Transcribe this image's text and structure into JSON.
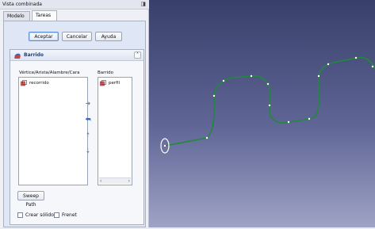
{
  "panel": {
    "title": "Vista combinada",
    "tabs": [
      {
        "label": "Modelo"
      },
      {
        "label": "Tareas"
      }
    ],
    "buttons": {
      "accept": "Aceptar",
      "cancel": "Cancelar",
      "help": "Ayuda"
    }
  },
  "task": {
    "title": "Barrido",
    "vertices_label": "Vértice/Arista/Alambre/Cara",
    "sweep_label": "Barrido",
    "left_items": [
      {
        "name": "recorrido"
      }
    ],
    "right_items": [
      {
        "name": "perfil"
      }
    ],
    "sweep_path_button": "Sweep Path",
    "create_solid_label": "Crear sólido",
    "frenet_label": "Frenet",
    "create_solid_checked": false,
    "frenet_checked": false
  },
  "colors": {
    "path_line": "#1e8a3a",
    "accent": "#2a6fd0"
  }
}
